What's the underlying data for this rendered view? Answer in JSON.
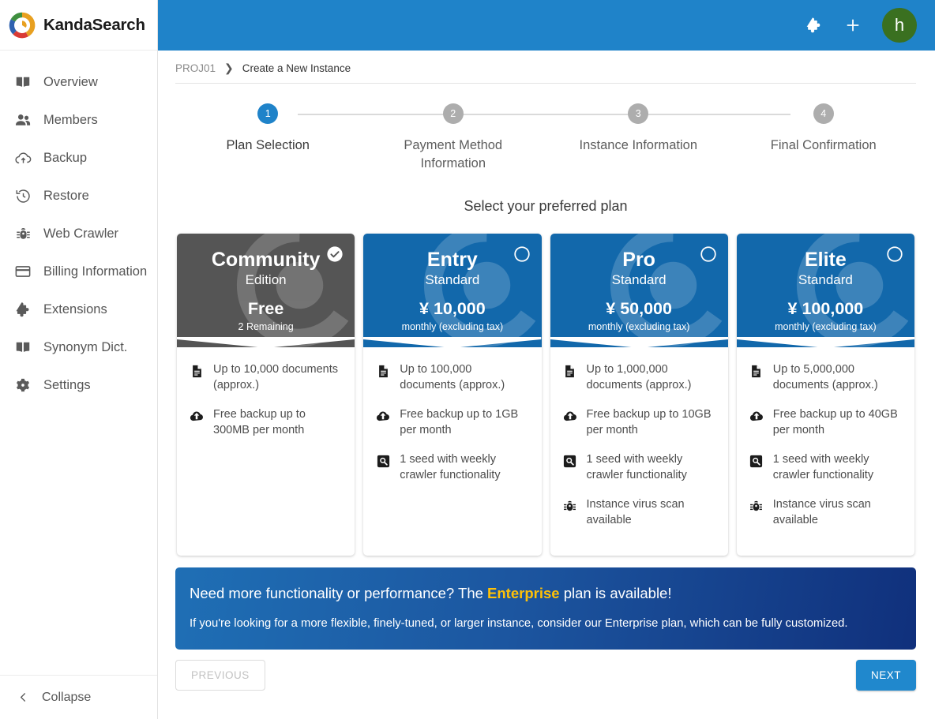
{
  "brand": {
    "name": "KandaSearch",
    "logo_icon": "kandasearch-logo-icon"
  },
  "sidebar": {
    "items": [
      {
        "label": "Overview",
        "icon": "book-icon"
      },
      {
        "label": "Members",
        "icon": "people-icon"
      },
      {
        "label": "Backup",
        "icon": "cloud-upload-icon"
      },
      {
        "label": "Restore",
        "icon": "history-restore-icon"
      },
      {
        "label": "Web Crawler",
        "icon": "bug-icon"
      },
      {
        "label": "Billing Information",
        "icon": "credit-card-icon"
      },
      {
        "label": "Extensions",
        "icon": "puzzle-piece-icon"
      },
      {
        "label": "Synonym Dict.",
        "icon": "book-icon"
      },
      {
        "label": "Settings",
        "icon": "gear-icon"
      }
    ],
    "collapse_label": "Collapse",
    "collapse_icon": "chevron-left-icon"
  },
  "topbar": {
    "background": "#1f83c9",
    "extensions_icon": "puzzle-piece-icon",
    "add_icon": "plus-icon",
    "avatar_initial": "h",
    "avatar_color": "#3a7020"
  },
  "breadcrumb": {
    "project": "PROJ01",
    "separator": "❯",
    "current": "Create a New Instance"
  },
  "stepper": {
    "steps": [
      {
        "number": "1",
        "label": "Plan Selection",
        "active": true
      },
      {
        "number": "2",
        "label": "Payment Method Information",
        "active": false
      },
      {
        "number": "3",
        "label": "Instance Information",
        "active": false
      },
      {
        "number": "4",
        "label": "Final Confirmation",
        "active": false
      }
    ],
    "active_color": "#1f83c9",
    "inactive_color": "#adadad"
  },
  "main": {
    "section_title": "Select your preferred plan"
  },
  "plans": [
    {
      "name": "Community",
      "tier": "Edition",
      "price": "Free",
      "note": "2 Remaining",
      "selected": true,
      "theme": "gray",
      "features": [
        {
          "icon": "document-icon",
          "text": "Up to 10,000 documents (approx.)"
        },
        {
          "icon": "cloud-upload-icon",
          "text": "Free backup up to 300MB per month"
        }
      ]
    },
    {
      "name": "Entry",
      "tier": "Standard",
      "price": "¥ 10,000",
      "note": "monthly (excluding tax)",
      "selected": false,
      "theme": "blue",
      "features": [
        {
          "icon": "document-icon",
          "text": "Up to 100,000 documents (approx.)"
        },
        {
          "icon": "cloud-upload-icon",
          "text": "Free backup up to 1GB per month"
        },
        {
          "icon": "search-box-icon",
          "text": "1 seed with weekly crawler functionality"
        }
      ]
    },
    {
      "name": "Pro",
      "tier": "Standard",
      "price": "¥ 50,000",
      "note": "monthly (excluding tax)",
      "selected": false,
      "theme": "blue",
      "features": [
        {
          "icon": "document-icon",
          "text": "Up to 1,000,000 documents (approx.)"
        },
        {
          "icon": "cloud-upload-icon",
          "text": "Free backup up to 10GB per month"
        },
        {
          "icon": "search-box-icon",
          "text": "1 seed with weekly crawler functionality"
        },
        {
          "icon": "bug-icon",
          "text": "Instance virus scan available"
        }
      ]
    },
    {
      "name": "Elite",
      "tier": "Standard",
      "price": "¥ 100,000",
      "note": "monthly (excluding tax)",
      "selected": false,
      "theme": "blue",
      "features": [
        {
          "icon": "document-icon",
          "text": "Up to 5,000,000 documents (approx.)"
        },
        {
          "icon": "cloud-upload-icon",
          "text": "Free backup up to 40GB per month"
        },
        {
          "icon": "search-box-icon",
          "text": "1 seed with weekly crawler functionality"
        },
        {
          "icon": "bug-icon",
          "text": "Instance virus scan available"
        }
      ]
    }
  ],
  "banner": {
    "title_before": "Need more functionality or performance? The ",
    "title_em": "Enterprise",
    "title_after": " plan is available!",
    "body": "If you're looking for a more flexible, finely-tuned, or larger instance, consider our Enterprise plan, which can be fully customized.",
    "em_color": "#ffc107"
  },
  "footer": {
    "previous_label": "PREVIOUS",
    "next_label": "NEXT",
    "next_color": "#2088cd"
  }
}
